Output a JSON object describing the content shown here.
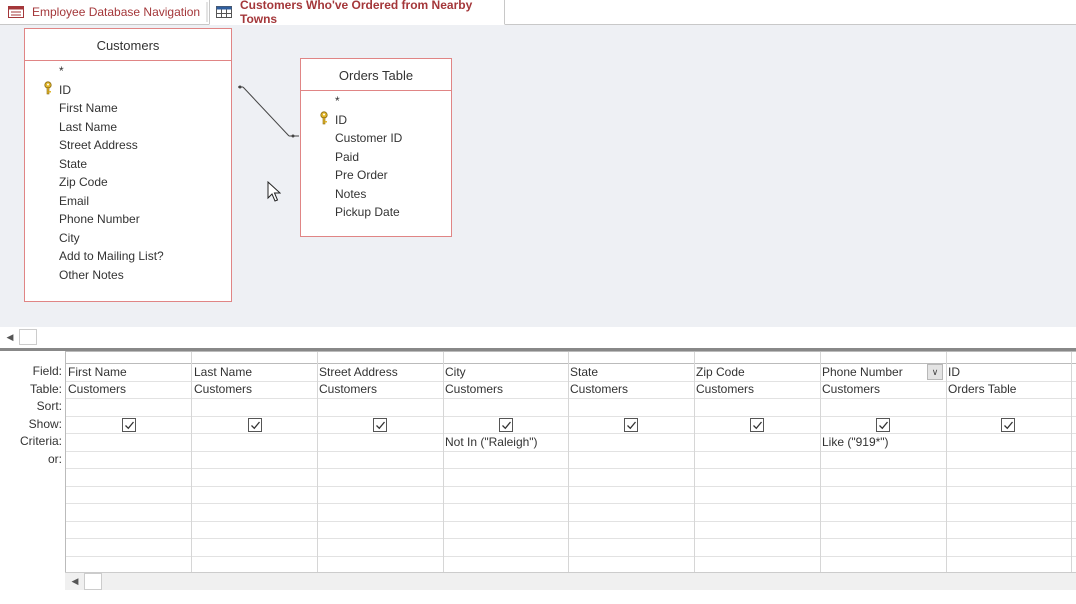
{
  "tabs": [
    {
      "label": "Employee Database Navigation"
    },
    {
      "label": "Customers Who've Ordered from Nearby Towns"
    }
  ],
  "tables": {
    "customers": {
      "title": "Customers",
      "fields": [
        "*",
        "ID",
        "First Name",
        "Last Name",
        "Street Address",
        "State",
        "Zip Code",
        "Email",
        "Phone Number",
        "City",
        "Add to Mailing List?",
        "Other Notes"
      ]
    },
    "orders": {
      "title": "Orders Table",
      "fields": [
        "*",
        "ID",
        "Customer ID",
        "Paid",
        "Pre Order",
        "Notes",
        "Pickup Date"
      ]
    }
  },
  "grid": {
    "row_labels": [
      "Field:",
      "Table:",
      "Sort:",
      "Show:",
      "Criteria:",
      "or:"
    ],
    "columns": [
      {
        "field": "First Name",
        "table": "Customers",
        "criteria": "",
        "show": true
      },
      {
        "field": "Last Name",
        "table": "Customers",
        "criteria": "",
        "show": true
      },
      {
        "field": "Street Address",
        "table": "Customers",
        "criteria": "",
        "show": true
      },
      {
        "field": "City",
        "table": "Customers",
        "criteria": "Not In (\"Raleigh\")",
        "show": true
      },
      {
        "field": "State",
        "table": "Customers",
        "criteria": "",
        "show": true
      },
      {
        "field": "Zip Code",
        "table": "Customers",
        "criteria": "",
        "show": true
      },
      {
        "field": "Phone Number",
        "table": "Customers",
        "criteria": "Like (\"919*\")",
        "show": true
      },
      {
        "field": "ID",
        "table": "Orders Table",
        "criteria": "",
        "show": true
      }
    ]
  },
  "colors": {
    "accent": "#a4373a",
    "table_border": "#e08585",
    "design_bg": "#eef0f4"
  }
}
